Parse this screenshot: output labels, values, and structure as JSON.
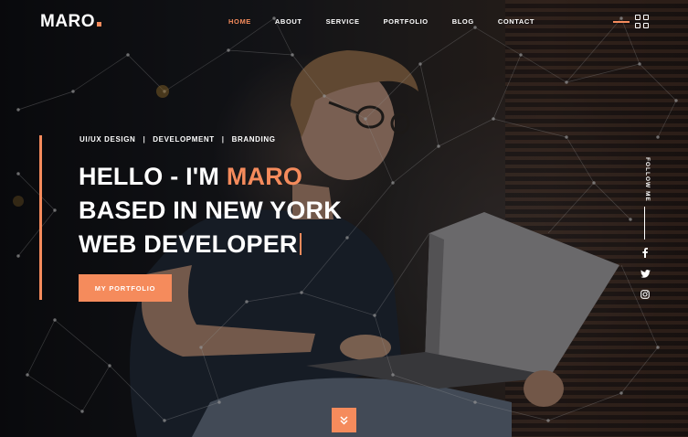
{
  "brand": {
    "logo": "MARO",
    "accent": "#f58b5c"
  },
  "nav": {
    "items": [
      {
        "label": "HOME",
        "active": true
      },
      {
        "label": "ABOUT"
      },
      {
        "label": "SERVICE"
      },
      {
        "label": "PORTFOLIO"
      },
      {
        "label": "BLOG"
      },
      {
        "label": "CONTACT"
      }
    ]
  },
  "hero": {
    "tags": [
      "UI/UX DESIGN",
      "DEVELOPMENT",
      "BRANDING"
    ],
    "tag_separator": "|",
    "line1_prefix": "HELLO - I'M ",
    "line1_name": "MARO",
    "line2": "BASED IN NEW YORK",
    "line3": "WEB DEVELOPER",
    "cta_label": "MY PORTFOLIO"
  },
  "follow": {
    "label": "FOLLOW ME",
    "icons": [
      "facebook-icon",
      "twitter-icon",
      "instagram-icon"
    ]
  },
  "scroll": {
    "icon": "double-chevron-down-icon"
  }
}
